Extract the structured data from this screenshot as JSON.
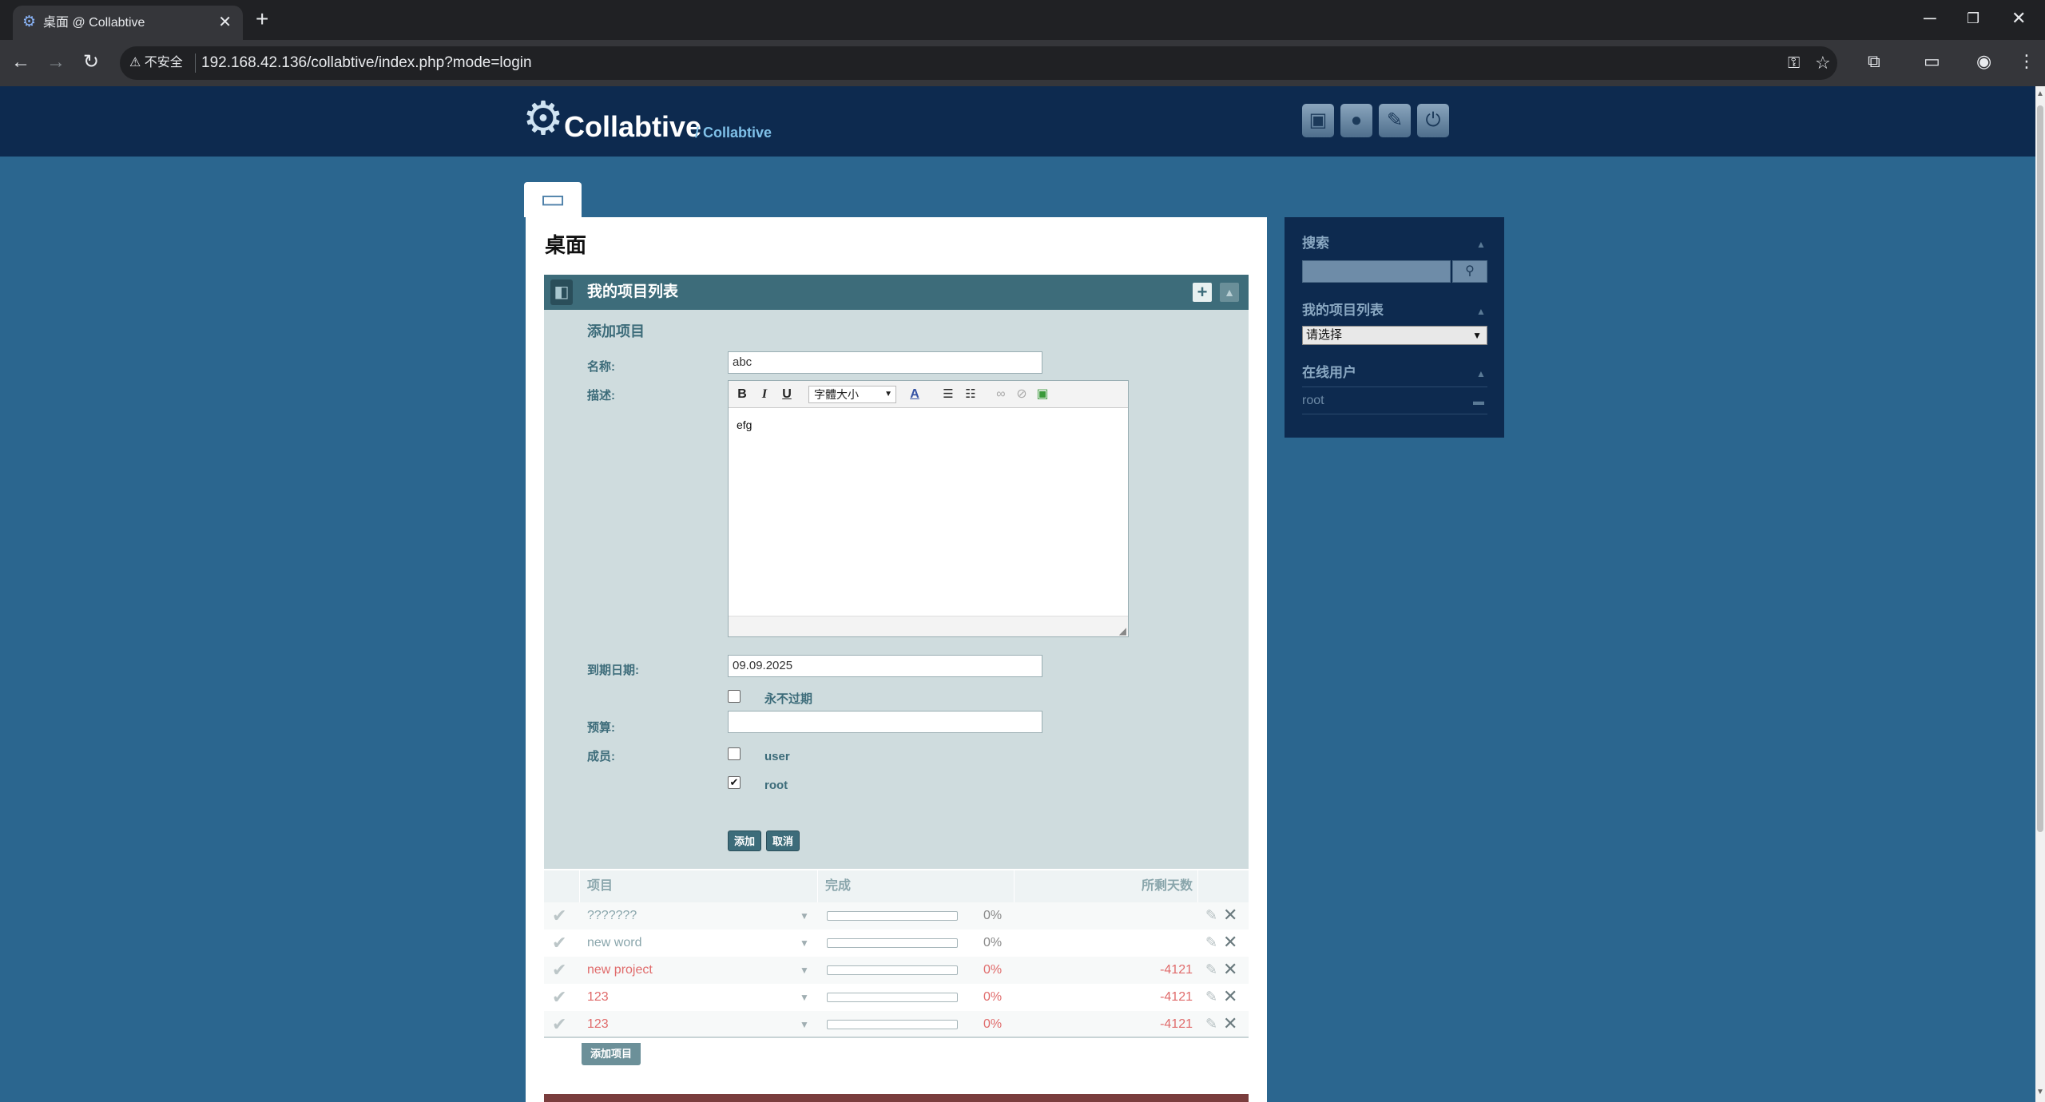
{
  "browser": {
    "tab_title": "桌面 @ Collabtive",
    "tab_favicon": "collabtive-gear-icon",
    "security_label": "不安全",
    "url": "192.168.42.136/collabtive/index.php?mode=login"
  },
  "header": {
    "logo_text": "Collabtive",
    "logo_sub": "/ Collabtive",
    "nav_icons": [
      "desktop-icon",
      "user-icon",
      "wrench-icon",
      "power-icon"
    ]
  },
  "page": {
    "title": "桌面"
  },
  "projects_panel": {
    "title": "我的项目列表",
    "form": {
      "title": "添加项目",
      "name_label": "名称:",
      "name_value": "abc",
      "desc_label": "描述:",
      "font_size_label": "字體大小",
      "desc_value": "efg",
      "due_label": "到期日期:",
      "due_value": "09.09.2025",
      "never_expire_label": "永不过期",
      "never_expire_checked": false,
      "budget_label": "预算:",
      "budget_value": "",
      "members_label": "成员:",
      "members": [
        {
          "name": "user",
          "checked": false
        },
        {
          "name": "root",
          "checked": true
        }
      ],
      "add_button": "添加",
      "cancel_button": "取消"
    },
    "table": {
      "headers": [
        "项目",
        "完成",
        "所剩天数"
      ],
      "rows": [
        {
          "name": "???????",
          "percent": "0%",
          "days_left": "",
          "overdue": false
        },
        {
          "name": "new word",
          "percent": "0%",
          "days_left": "",
          "overdue": false
        },
        {
          "name": "new project",
          "percent": "0%",
          "days_left": "-4121",
          "overdue": true
        },
        {
          "name": "123",
          "percent": "0%",
          "days_left": "-4121",
          "overdue": true
        },
        {
          "name": "123",
          "percent": "0%",
          "days_left": "-4121",
          "overdue": true
        }
      ]
    },
    "add_project_button": "添加项目"
  },
  "sidebar": {
    "search_title": "搜索",
    "search_value": "",
    "projects_title": "我的项目列表",
    "projects_select": "请选择",
    "online_title": "在线用户",
    "online_users": [
      "root"
    ]
  },
  "colors": {
    "page_bg": "#2b668f",
    "header_bg": "#0d2a4f",
    "panel_header": "#3d6c7a",
    "form_bg": "#cfdcde",
    "overdue_text": "#e06b6b",
    "normal_text": "#8aa6ac"
  }
}
